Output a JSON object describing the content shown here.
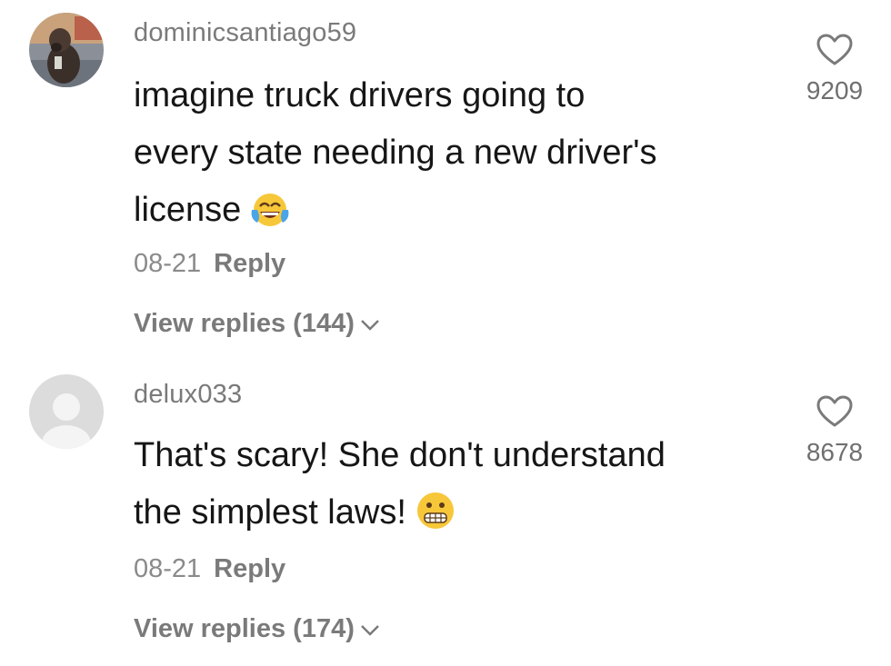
{
  "comments": [
    {
      "username": "dominicsantiago59",
      "text_lines": [
        "imagine truck drivers going to",
        "every state needing a new driver's",
        "license"
      ],
      "emoji": "face-with-tears-of-joy",
      "date": "08-21",
      "reply_label": "Reply",
      "view_replies_label": "View replies (144)",
      "like_count": "9209"
    },
    {
      "username": "delux033",
      "text_lines": [
        "That's scary! She don't understand",
        "the simplest laws!"
      ],
      "emoji": "grimacing-face",
      "date": "08-21",
      "reply_label": "Reply",
      "view_replies_label": "View replies (174)",
      "like_count": "8678"
    }
  ],
  "colors": {
    "username": "#7a7a7a",
    "text": "#161616",
    "meta": "#8a8a8a",
    "emoji_yellow": "#f7c73a"
  },
  "icons": [
    "avatar-photo",
    "default-avatar",
    "heart-outline-icon",
    "chevron-down-icon"
  ]
}
